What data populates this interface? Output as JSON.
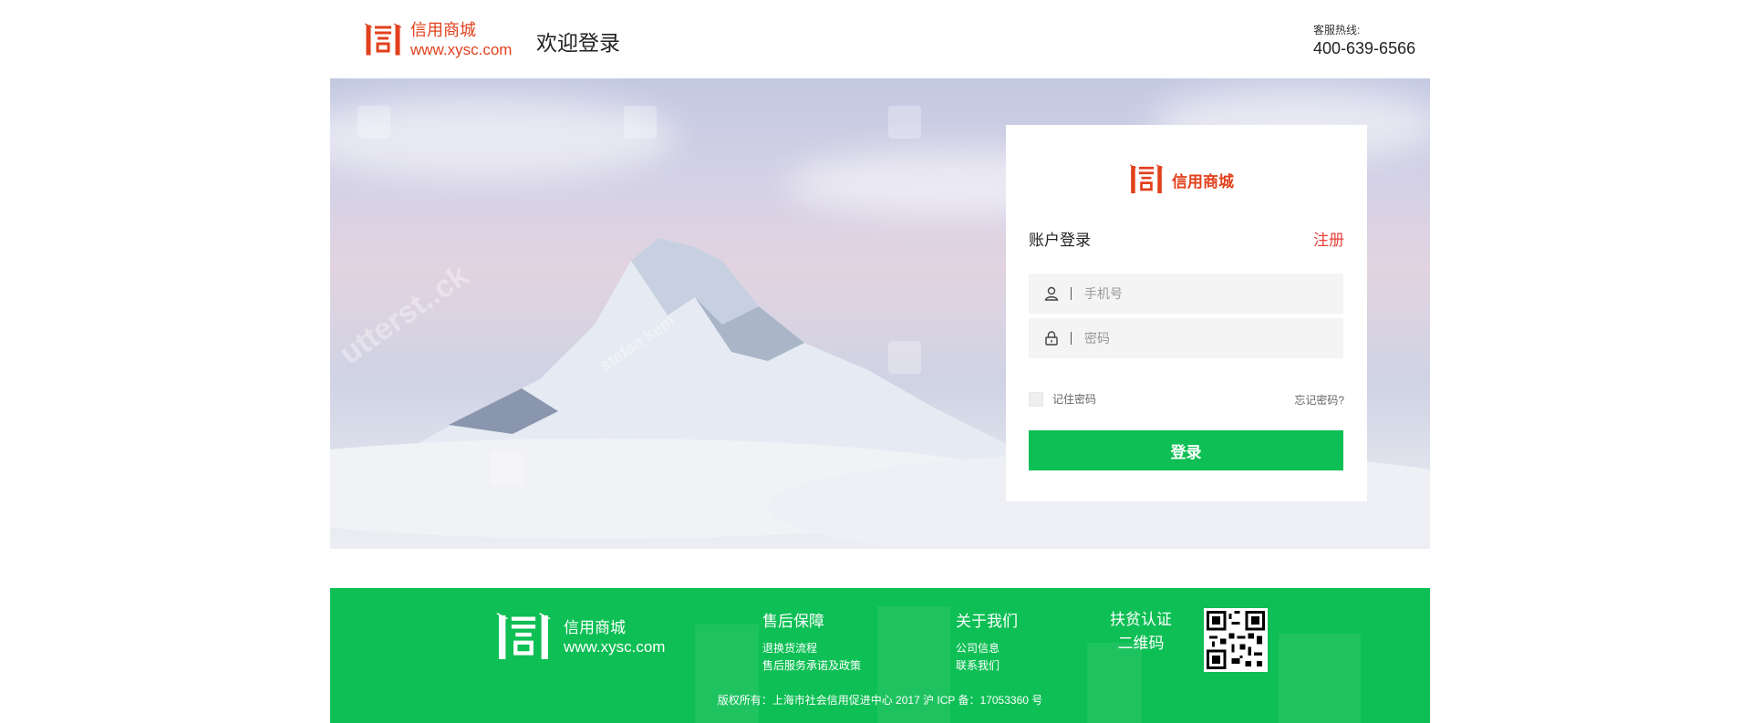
{
  "header": {
    "brand_name": "信用商城",
    "brand_url": "www.xysc.com",
    "welcome": "欢迎登录",
    "hotline_label": "客服热线:",
    "hotline_number": "400-639-6566"
  },
  "hero": {
    "watermark_text_1": "stefan kem",
    "watermark_text_2": "utterst..ck"
  },
  "login": {
    "brand_name": "信用商城",
    "title": "账户登录",
    "register_label": "注册",
    "phone_placeholder": "手机号",
    "password_placeholder": "密码",
    "remember_label": "记住密码",
    "forgot_label": "忘记密码?",
    "submit_label": "登录"
  },
  "footer": {
    "brand_name": "信用商城",
    "brand_url": "www.xysc.com",
    "after_sales": {
      "heading": "售后保障",
      "links": [
        "退换货流程",
        "售后服务承诺及政策"
      ]
    },
    "about": {
      "heading": "关于我们",
      "links": [
        "公司信息",
        "联系我们"
      ]
    },
    "cert_line1": "扶贫认证",
    "cert_line2": "二维码",
    "copyright": "版权所有：上海市社会信用促进中心 2017 沪 ICP 备：17053360 号"
  },
  "colors": {
    "brand_red": "#e2401c",
    "register_red": "#e8413b",
    "primary_green": "#0dbf54"
  },
  "icons": {
    "user": "user-icon",
    "lock": "lock-icon",
    "logo": "xysc-logo-icon",
    "qr": "qr-code-icon"
  }
}
